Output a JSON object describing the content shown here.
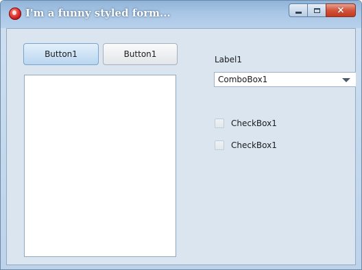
{
  "window": {
    "title": "I'm a funny styled form...",
    "controls": {
      "minimize": "minimize",
      "maximize": "maximize",
      "close": "×"
    }
  },
  "form": {
    "button_a": "Button1",
    "button_b": "Button1",
    "label": "Label1",
    "combobox": {
      "value": "ComboBox1"
    },
    "checkboxes": [
      {
        "label": "CheckBox1",
        "checked": false
      },
      {
        "label": "CheckBox1",
        "checked": false
      }
    ]
  },
  "colors": {
    "titlebar": "#a9c6e5",
    "client": "#dbe5f0",
    "close_button": "#d2553b"
  }
}
